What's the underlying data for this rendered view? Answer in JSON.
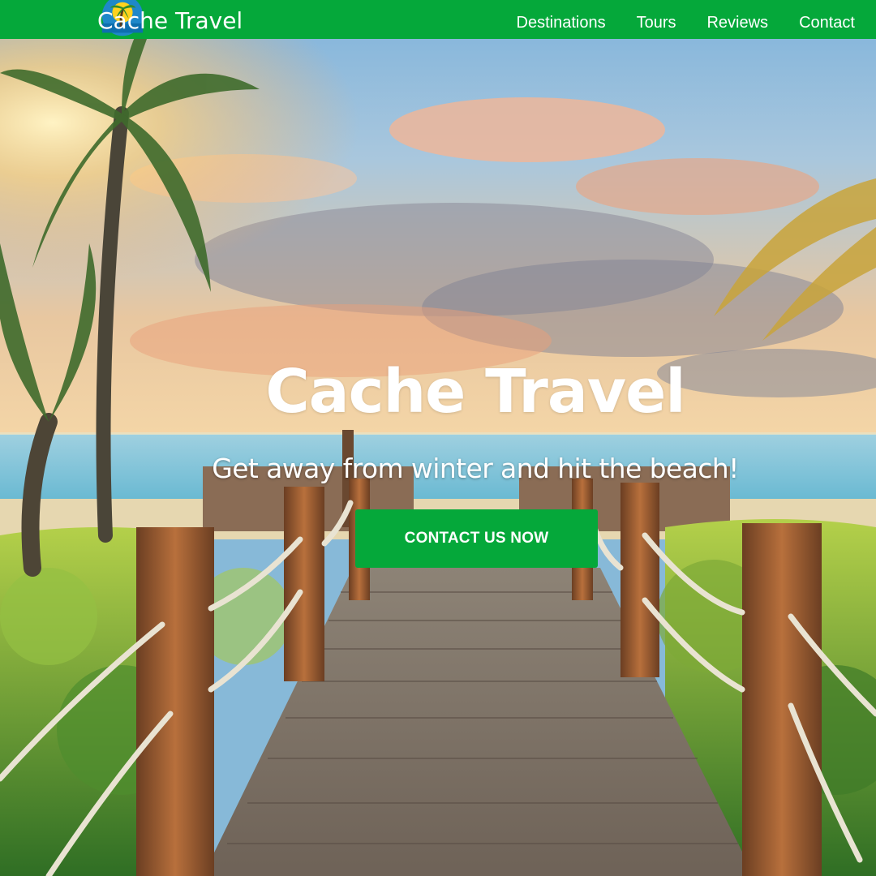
{
  "nav": {
    "brand": "Cache Travel",
    "logo": "palm-tree-sunset-logo",
    "links": [
      "Destinations",
      "Tours",
      "Reviews",
      "Contact"
    ]
  },
  "hero": {
    "title": "Cache Travel",
    "subtitle": "Get away from winter and hit the beach!",
    "cta_label": "CONTACT US NOW",
    "background": "beach-boardwalk-sunset-photo"
  },
  "colors": {
    "brand_green": "#05a83a",
    "text_white": "#ffffff"
  }
}
